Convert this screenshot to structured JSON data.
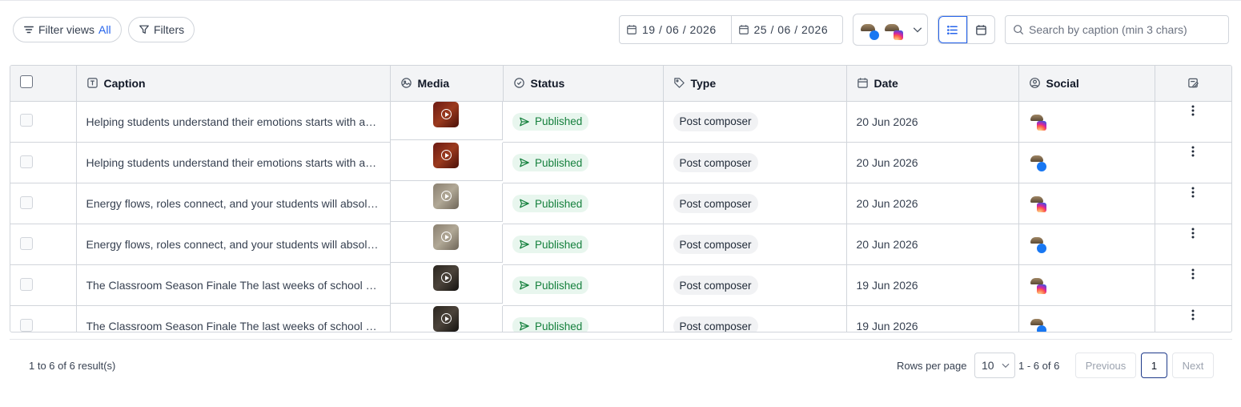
{
  "toolbar": {
    "filter_views_label": "Filter views",
    "filter_views_value": "All",
    "filters_label": "Filters",
    "date_from": "19 / 06 / 2026",
    "date_to": "25 / 06 / 2026",
    "search_placeholder": "Search by caption (min 3 chars)"
  },
  "table": {
    "columns": [
      {
        "label": "Caption",
        "icon": "text-icon"
      },
      {
        "label": "Media",
        "icon": "image-icon"
      },
      {
        "label": "Status",
        "icon": "check-circle-icon"
      },
      {
        "label": "Type",
        "icon": "tag-icon"
      },
      {
        "label": "Date",
        "icon": "calendar-icon"
      },
      {
        "label": "Social",
        "icon": "user-circle-icon"
      }
    ],
    "rows": [
      {
        "caption": "Helping students understand their emotions starts with a safe space to express them",
        "status": "Published",
        "type": "Post composer",
        "date": "20 Jun 2026",
        "network": "instagram"
      },
      {
        "caption": "Helping students understand their emotions starts with a safe space to express them",
        "status": "Published",
        "type": "Post composer",
        "date": "20 Jun 2026",
        "network": "facebook"
      },
      {
        "caption": "Energy flows, roles connect, and your students will absolutely love this activity",
        "status": "Published",
        "type": "Post composer",
        "date": "20 Jun 2026",
        "network": "instagram"
      },
      {
        "caption": "Energy flows, roles connect, and your students will absolutely love this activity",
        "status": "Published",
        "type": "Post composer",
        "date": "20 Jun 2026",
        "network": "facebook"
      },
      {
        "caption": "The Classroom Season Finale The last weeks of school are the perfect time",
        "status": "Published",
        "type": "Post composer",
        "date": "19 Jun 2026",
        "network": "instagram"
      },
      {
        "caption": "The Classroom Season Finale The last weeks of school are the perfect time",
        "status": "Published",
        "type": "Post composer",
        "date": "19 Jun 2026",
        "network": "facebook"
      }
    ]
  },
  "footer": {
    "results": "1 to 6 of 6 result(s)",
    "rows_per_page_label": "Rows per page",
    "rows_per_page_value": "10",
    "range": "1 - 6 of 6",
    "previous": "Previous",
    "page": "1",
    "next": "Next"
  },
  "colors": {
    "accent": "#2563eb",
    "published_bg": "#e8f6ee",
    "published_text": "#15803d",
    "facebook": "#1877f2"
  }
}
